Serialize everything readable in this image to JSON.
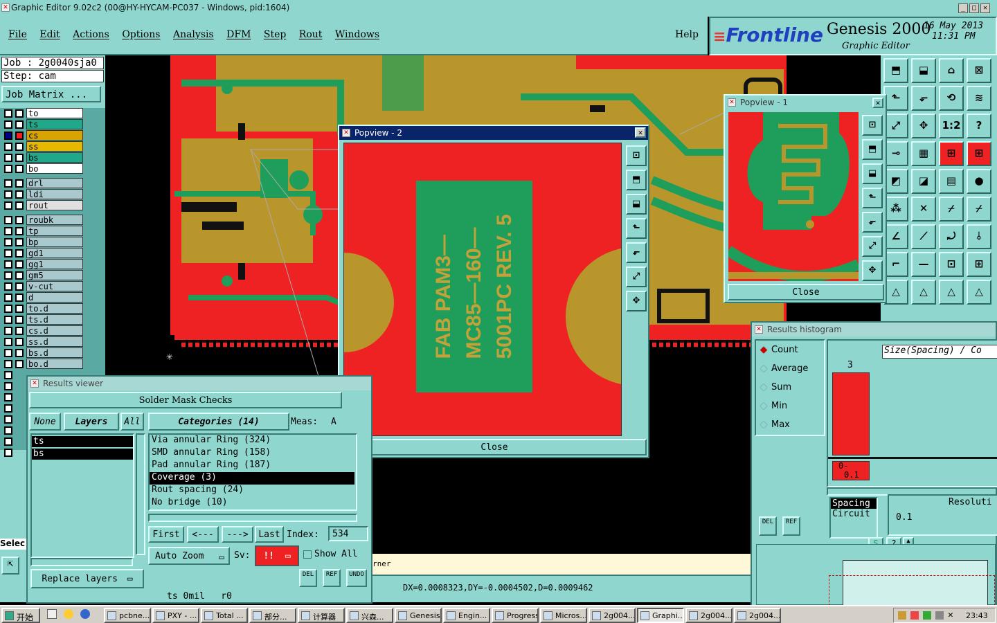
{
  "window": {
    "title": "Graphic Editor 9.02c2 (00@HY-HYCAM-PC037 - Windows, pid:1604)"
  },
  "menu": {
    "items": [
      "File",
      "Edit",
      "Actions",
      "Options",
      "Analysis",
      "DFM",
      "Step",
      "Rout",
      "Windows"
    ],
    "help": "Help"
  },
  "brand": {
    "logo": "Frontline",
    "product": "Genesis 2000",
    "subtitle": "Graphic Editor",
    "date": "16 May 2013",
    "time": "11:31 PM"
  },
  "job": {
    "job_label": "Job : 2g0040sja0",
    "step_label": "Step: cam",
    "matrix_button": "Job Matrix ..."
  },
  "layers": [
    {
      "name": "to",
      "color": "#ffffff"
    },
    {
      "name": "ts",
      "color": "#1fa88a"
    },
    {
      "name": "cs",
      "color": "#d9a300"
    },
    {
      "name": "ss",
      "color": "#e6b800"
    },
    {
      "name": "bs",
      "color": "#1fa88a"
    },
    {
      "name": "bo",
      "color": "#ffffff"
    },
    {
      "name": "drl",
      "color": "#a9c9cf"
    },
    {
      "name": "ldi",
      "color": "#a9c9cf"
    },
    {
      "name": "rout",
      "color": "#e0e0e0"
    },
    {
      "name": "roubk",
      "color": "#a9c9cf"
    },
    {
      "name": "tp",
      "color": "#a9c9cf"
    },
    {
      "name": "bp",
      "color": "#a9c9cf"
    },
    {
      "name": "gd1",
      "color": "#a9c9cf"
    },
    {
      "name": "gg1",
      "color": "#a9c9cf"
    },
    {
      "name": "gm5",
      "color": "#a9c9cf"
    },
    {
      "name": "v-cut",
      "color": "#a9c9cf"
    },
    {
      "name": "d",
      "color": "#a9c9cf"
    },
    {
      "name": "to.d",
      "color": "#a9c9cf"
    },
    {
      "name": "ts.d",
      "color": "#a9c9cf"
    },
    {
      "name": "cs.d",
      "color": "#a9c9cf"
    },
    {
      "name": "ss.d",
      "color": "#a9c9cf"
    },
    {
      "name": "bs.d",
      "color": "#a9c9cf"
    },
    {
      "name": "bo.d",
      "color": "#a9c9cf"
    }
  ],
  "sidebar_select_label": "Selec",
  "popview2": {
    "title": "Popview - 2",
    "close": "Close",
    "board_text": [
      "FAB PAM3—",
      "MC85—160—",
      "5001PC REV. 5"
    ]
  },
  "popview1": {
    "title": "Popview - 1",
    "close": "Close"
  },
  "results_viewer": {
    "title": "Results viewer",
    "header": "Solder Mask Checks",
    "none": "None",
    "layers": "Layers",
    "all": "All",
    "categories": "Categories (14)",
    "meas": "Meas:",
    "meas_val": "A",
    "layer_list": [
      "ts",
      "bs"
    ],
    "cat_list": [
      "Via annular Ring (324)",
      "SMD annular Ring (158)",
      "Pad annular Ring (187)",
      "Coverage (3)",
      "Rout spacing (24)",
      "No bridge (10)"
    ],
    "first": "First",
    "prev": "<---",
    "next": "--->",
    "last": "Last",
    "index_label": "Index:",
    "index_value": "534",
    "autozoom": "Auto Zoom",
    "sv": "Sv:",
    "sv_val": "!!",
    "showall": "Show All",
    "replace": "Replace layers",
    "del": "DEL",
    "ref": "REF",
    "undo": "UNDO",
    "status": "ts 0mil   r0"
  },
  "histogram": {
    "title": "Results histogram",
    "options": [
      "Count",
      "Average",
      "Sum",
      "Min",
      "Max"
    ],
    "size_label": "Size(Spacing) / Co",
    "bar_count": "3",
    "bar_range_lo": "0-",
    "bar_range_hi": "0.1",
    "list_hdr": "Spacing",
    "list_item": "Circuit",
    "resol": "Resoluti",
    "resol_val": "0.1",
    "del": "DEL",
    "ref": "REF"
  },
  "chart_data": {
    "type": "bar",
    "categories": [
      "0-0.1"
    ],
    "values": [
      3
    ]
  },
  "statusbar": {
    "corner_text": "rner",
    "coords": "DX=0.0008323,DY=-0.0004502,D=0.0009462"
  },
  "taskbar": {
    "start": "开始",
    "items": [
      "pcbne...",
      "PXY - ...",
      "Total ...",
      "部分...",
      "计算器",
      "兴森...",
      "Genesis",
      "Engin...",
      "Progress",
      "Micros...",
      "2g004...",
      "Graphi...",
      "2g004...",
      "2g004..."
    ],
    "clock": "23:43"
  }
}
